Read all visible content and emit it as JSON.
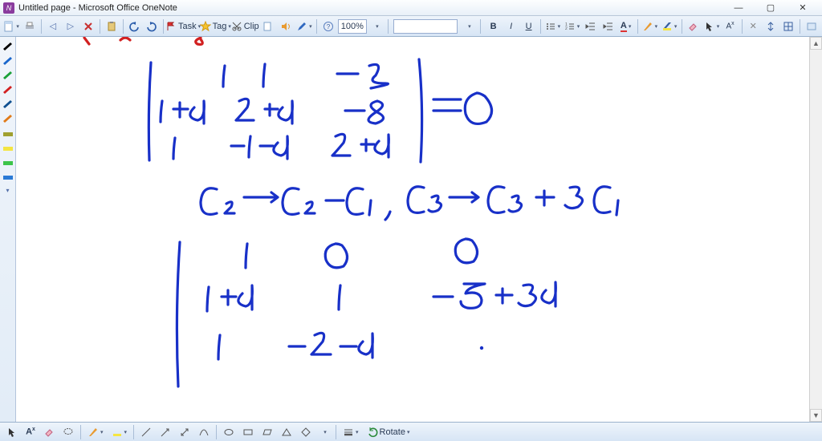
{
  "window": {
    "title": "Untitled page - Microsoft Office OneNote"
  },
  "toolbar": {
    "task_label": "Task",
    "tag_label": "Tag",
    "clip_label": "Clip",
    "zoom": "100%"
  },
  "draw_toolbar": {
    "rotate_label": "Rotate"
  },
  "pens": [
    {
      "color": "#000000"
    },
    {
      "color": "#1a66cc"
    },
    {
      "color": "#1aa038"
    },
    {
      "color": "#d22020"
    },
    {
      "color": "#105090"
    },
    {
      "color": "#e07a18"
    },
    {
      "color": "#a0a030"
    },
    {
      "color": "#f4e542"
    },
    {
      "color": "#3cc44a"
    },
    {
      "color": "#2a7ad6"
    }
  ],
  "handwriting": {
    "stroke": "#1830c8",
    "stroke_width": 3.2,
    "content_description": "Determinant matrix with column operations",
    "matrix1": [
      [
        "1",
        "1",
        "-3"
      ],
      [
        "1+d",
        "2+d",
        "-8"
      ],
      [
        "1",
        "-1-d",
        "2+d"
      ]
    ],
    "rhs1": "=0",
    "ops": "C₂→C₂−C₁ , C₃→C₃+3C₁",
    "matrix2": [
      [
        "1",
        "0",
        "0"
      ],
      [
        "1+d",
        "1",
        "-5+3d"
      ],
      [
        "1",
        "-2-d",
        ""
      ]
    ]
  }
}
